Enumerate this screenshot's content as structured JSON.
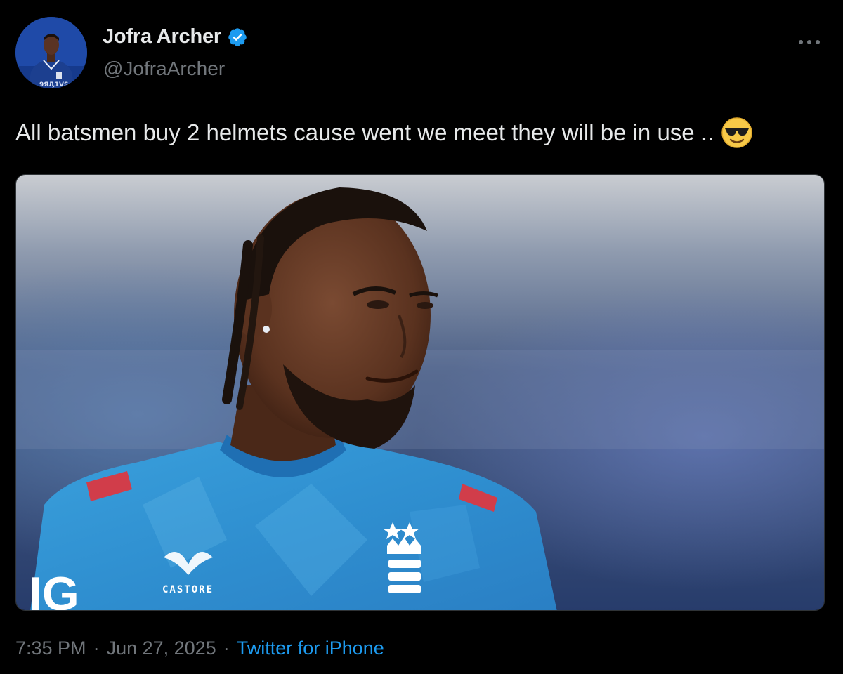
{
  "author": {
    "display_name": "Jofra Archer",
    "handle": "@JofraArcher",
    "verified_icon": "verified-badge-icon",
    "avatar_icon": "profile-photo"
  },
  "tweet": {
    "text": "All batsmen buy 2 helmets cause went we meet they will be in use ..",
    "emoji": "smiling-face-with-sunglasses"
  },
  "media": {
    "description_icon": "photo-attachment",
    "jersey_sponsor": "CASTORE",
    "sleeve_text": "IG"
  },
  "meta": {
    "time": "7:35 PM",
    "date": "Jun 27, 2025",
    "separator": "·",
    "source": "Twitter for iPhone"
  },
  "colors": {
    "background": "#000000",
    "primary_text": "#e7e9ea",
    "secondary_text": "#71767b",
    "accent": "#1d9bf0"
  }
}
